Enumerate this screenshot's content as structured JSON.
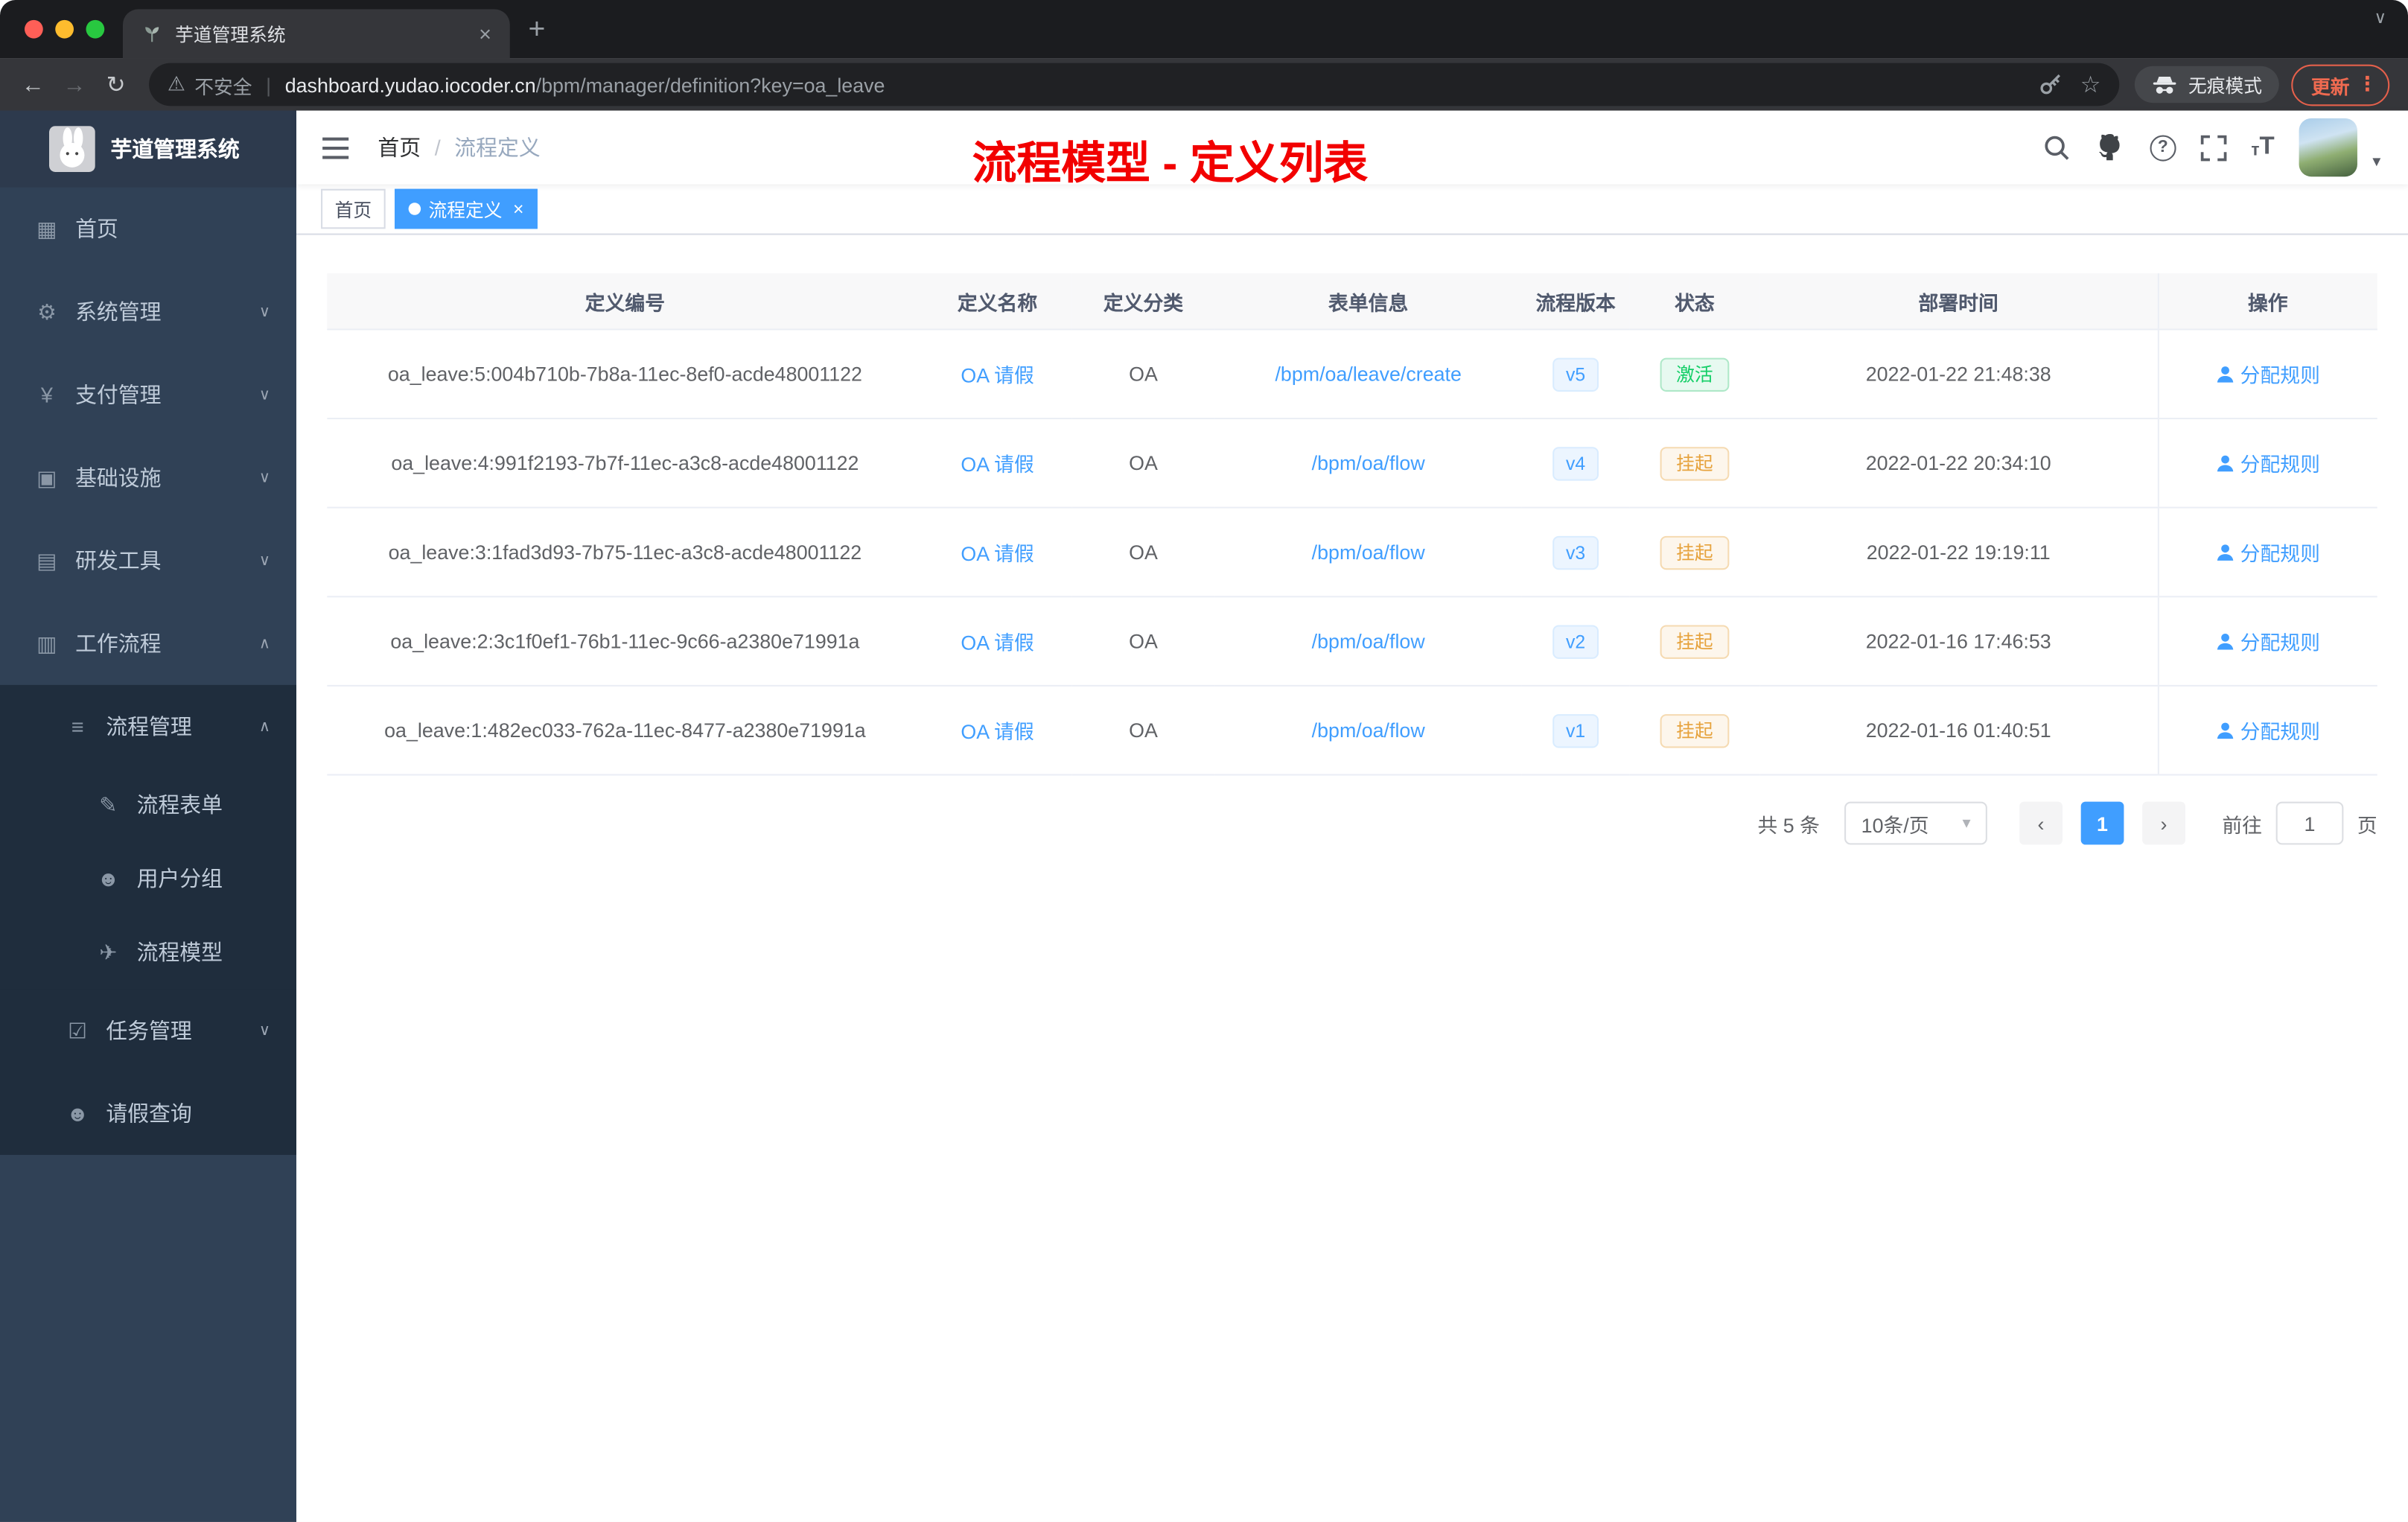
{
  "browser": {
    "tab": {
      "title": "芋道管理系统",
      "close_label": "×"
    },
    "new_tab_label": "+",
    "address": {
      "security_label": "不安全",
      "domain": "dashboard.yudao.iocoder.cn",
      "path": "/bpm/manager/definition?key=oa_leave"
    },
    "incognito_label": "无痕模式",
    "update_label": "更新"
  },
  "sidebar": {
    "logo_title": "芋道管理系统",
    "items": [
      {
        "key": "home",
        "label": "首页",
        "icon": "dashboard-icon"
      },
      {
        "key": "system",
        "label": "系统管理",
        "icon": "gear-icon",
        "expandable": true
      },
      {
        "key": "payment",
        "label": "支付管理",
        "icon": "yen-icon",
        "expandable": true
      },
      {
        "key": "infrastructure",
        "label": "基础设施",
        "icon": "infrastructure-icon",
        "expandable": true
      },
      {
        "key": "devtools",
        "label": "研发工具",
        "icon": "tools-icon",
        "expandable": true
      },
      {
        "key": "workflow",
        "label": "工作流程",
        "icon": "workflow-icon",
        "expandable": true,
        "expanded": true,
        "children": [
          {
            "key": "process-management",
            "label": "流程管理",
            "icon": "process-management-icon",
            "expandable": true,
            "expanded": true,
            "children": [
              {
                "key": "process-form",
                "label": "流程表单",
                "icon": "form-icon"
              },
              {
                "key": "user-group",
                "label": "用户分组",
                "icon": "user-group-icon"
              },
              {
                "key": "process-model",
                "label": "流程模型",
                "icon": "paper-plane-icon"
              }
            ]
          },
          {
            "key": "task-management",
            "label": "任务管理",
            "icon": "task-icon",
            "expandable": true
          },
          {
            "key": "leave-query",
            "label": "请假查询",
            "icon": "user-icon"
          }
        ]
      }
    ]
  },
  "navbar": {
    "breadcrumb": [
      "首页",
      "流程定义"
    ],
    "annotation": "流程模型 - 定义列表"
  },
  "tags": [
    {
      "label": "首页",
      "active": false,
      "closable": false
    },
    {
      "label": "流程定义",
      "active": true,
      "closable": true
    }
  ],
  "table": {
    "columns": [
      "定义编号",
      "定义名称",
      "定义分类",
      "表单信息",
      "流程版本",
      "状态",
      "部署时间",
      "操作"
    ],
    "rows": [
      {
        "id": "oa_leave:5:004b710b-7b8a-11ec-8ef0-acde48001122",
        "name": "OA 请假",
        "category": "OA",
        "form": "/bpm/oa/leave/create",
        "version": "v5",
        "status": "激活",
        "status_type": "success",
        "deploy_time": "2022-01-22 21:48:38",
        "action": "分配规则"
      },
      {
        "id": "oa_leave:4:991f2193-7b7f-11ec-a3c8-acde48001122",
        "name": "OA 请假",
        "category": "OA",
        "form": "/bpm/oa/flow",
        "version": "v4",
        "status": "挂起",
        "status_type": "warning",
        "deploy_time": "2022-01-22 20:34:10",
        "action": "分配规则"
      },
      {
        "id": "oa_leave:3:1fad3d93-7b75-11ec-a3c8-acde48001122",
        "name": "OA 请假",
        "category": "OA",
        "form": "/bpm/oa/flow",
        "version": "v3",
        "status": "挂起",
        "status_type": "warning",
        "deploy_time": "2022-01-22 19:19:11",
        "action": "分配规则"
      },
      {
        "id": "oa_leave:2:3c1f0ef1-76b1-11ec-9c66-a2380e71991a",
        "name": "OA 请假",
        "category": "OA",
        "form": "/bpm/oa/flow",
        "version": "v2",
        "status": "挂起",
        "status_type": "warning",
        "deploy_time": "2022-01-16 17:46:53",
        "action": "分配规则"
      },
      {
        "id": "oa_leave:1:482ec033-762a-11ec-8477-a2380e71991a",
        "name": "OA 请假",
        "category": "OA",
        "form": "/bpm/oa/flow",
        "version": "v1",
        "status": "挂起",
        "status_type": "warning",
        "deploy_time": "2022-01-16 01:40:51",
        "action": "分配规则"
      }
    ]
  },
  "pagination": {
    "total": "共 5 条",
    "page_size": "10条/页",
    "pages": [
      "1"
    ],
    "current_page": "1",
    "goto_label": "前往",
    "goto_value": "1",
    "unit_label": "页"
  },
  "colors": {
    "accent": "#409eff",
    "success": "#13ce66",
    "warning": "#e6a23c",
    "annotation_red": "#f20000",
    "sidebar_bg": "#304156",
    "submenu_bg": "#1f2d3d"
  }
}
